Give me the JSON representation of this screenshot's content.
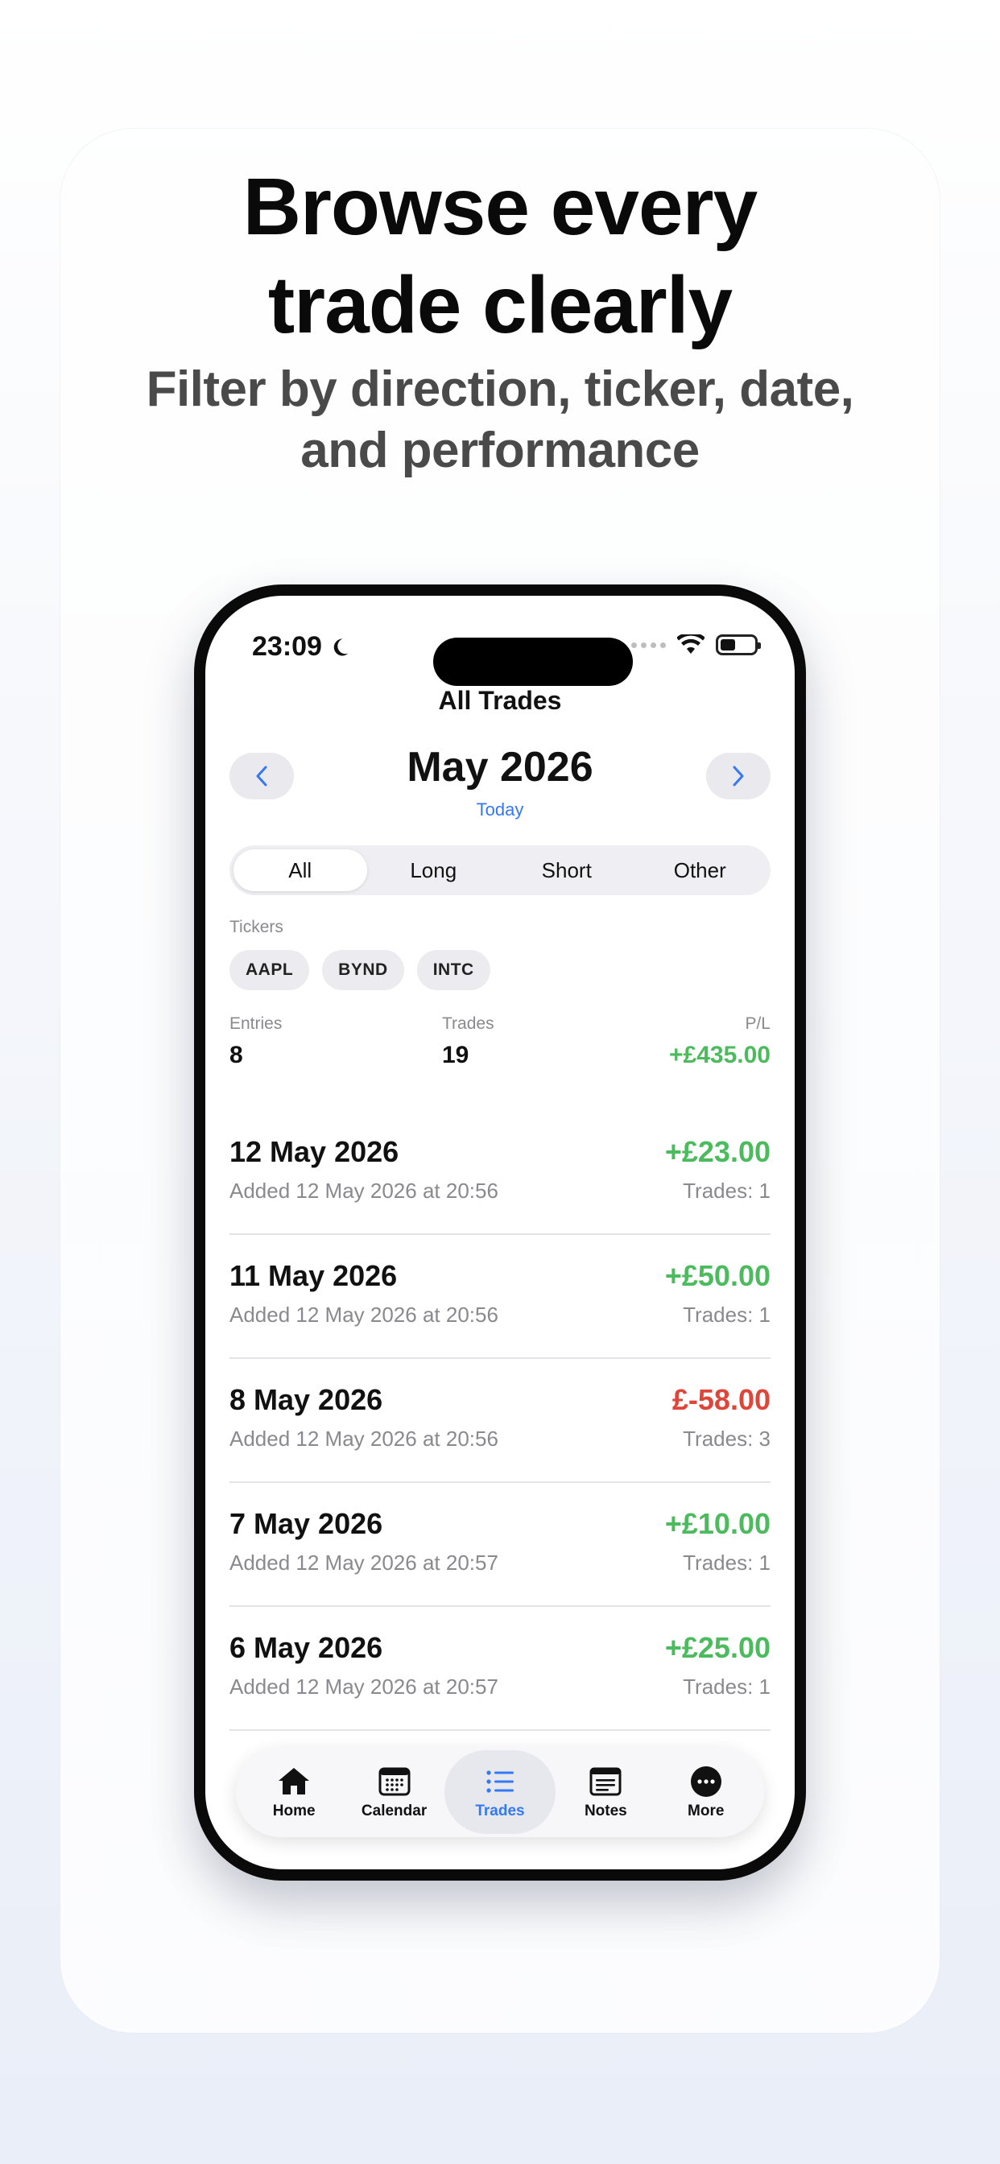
{
  "promo": {
    "headline_line1": "Browse every",
    "headline_line2": "trade clearly",
    "subheadline_line1": "Filter by direction, ticker, date,",
    "subheadline_line2": "and performance"
  },
  "status_bar": {
    "time": "23:09"
  },
  "screen": {
    "title": "All Trades",
    "month": "May 2026",
    "today_label": "Today",
    "filters": [
      {
        "label": "All",
        "selected": true
      },
      {
        "label": "Long",
        "selected": false
      },
      {
        "label": "Short",
        "selected": false
      },
      {
        "label": "Other",
        "selected": false
      }
    ],
    "tickers_label": "Tickers",
    "tickers": [
      "AAPL",
      "BYND",
      "INTC"
    ],
    "summary": {
      "entries_label": "Entries",
      "entries_value": "8",
      "trades_label": "Trades",
      "trades_value": "19",
      "pl_label": "P/L",
      "pl_value": "+£435.00"
    },
    "entries": [
      {
        "date": "12 May 2026",
        "added": "Added 12 May 2026 at 20:56",
        "pl": "+£23.00",
        "trades": "Trades: 1",
        "positive": true
      },
      {
        "date": "11 May 2026",
        "added": "Added 12 May 2026 at 20:56",
        "pl": "+£50.00",
        "trades": "Trades: 1",
        "positive": true
      },
      {
        "date": "8 May 2026",
        "added": "Added 12 May 2026 at 20:56",
        "pl": "£-58.00",
        "trades": "Trades: 3",
        "positive": false
      },
      {
        "date": "7 May 2026",
        "added": "Added 12 May 2026 at 20:57",
        "pl": "+£10.00",
        "trades": "Trades: 1",
        "positive": true
      },
      {
        "date": "6 May 2026",
        "added": "Added 12 May 2026 at 20:57",
        "pl": "+£25.00",
        "trades": "Trades: 1",
        "positive": true
      }
    ]
  },
  "tab_bar": {
    "tabs": [
      {
        "label": "Home",
        "icon": "house-icon",
        "active": false
      },
      {
        "label": "Calendar",
        "icon": "calendar-icon",
        "active": false
      },
      {
        "label": "Trades",
        "icon": "list-icon",
        "active": true
      },
      {
        "label": "Notes",
        "icon": "notes-icon",
        "active": false
      },
      {
        "label": "More",
        "icon": "more-icon",
        "active": false
      }
    ]
  },
  "colors": {
    "accent": "#3478f6",
    "positive": "#4cbb5e",
    "negative": "#e0453a"
  }
}
